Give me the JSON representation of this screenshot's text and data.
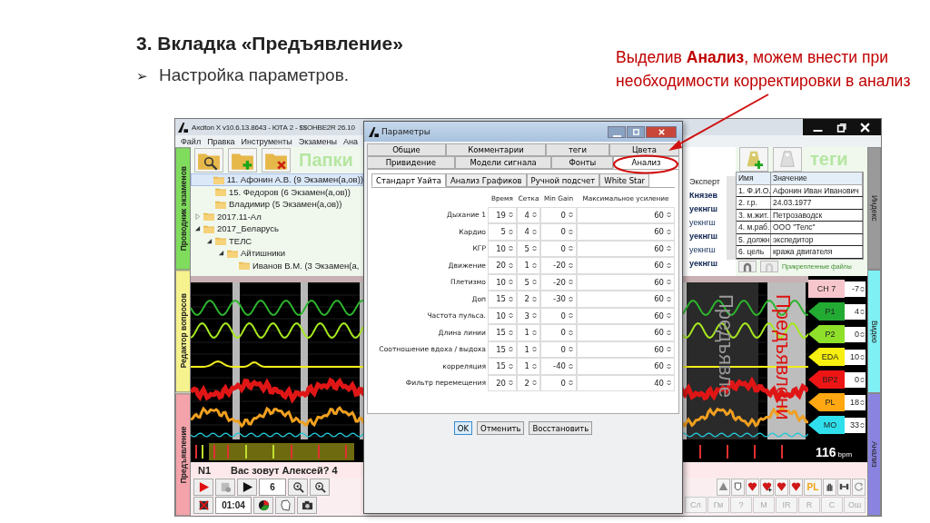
{
  "slide": {
    "title": "3. Вкладка «Предъявление»",
    "bullet": "➢",
    "subtitle": "Настройка параметров.",
    "note": "Выделив **Анализ**,  можем внести при необходимости корректировки в анализ"
  },
  "app": {
    "title": "Axciton X v10.6.13.8643 - ЮТА 2 - $$OHBE2R 26.10",
    "menu": [
      "Файл",
      "Правка",
      "Инструменты",
      "Экзамены",
      "Ана"
    ],
    "left_tabs": [
      {
        "label": "Проводник экзаменов",
        "color": "#7fdc5c"
      },
      {
        "label": "Редактор вопросов",
        "color": "#f6f28e"
      },
      {
        "label": "Предъявление",
        "color": "#f4a3ab"
      }
    ],
    "right_tabs": [
      {
        "label": "Индекс",
        "color": "#9a9a9a"
      },
      {
        "label": "Видео",
        "color": "#7ff0f4"
      },
      {
        "label": "Анализ",
        "color": "#8a84e0"
      }
    ],
    "folders_label": "Папки",
    "tree": [
      {
        "children": [
          {
            "label": "11. Афонин А.В. (9 Экзамен(а,ов))",
            "selected": true
          },
          {
            "label": "15. Федоров (6 Экзамен(а,ов))",
            "selected": false
          },
          {
            "label": "Владимир (5 Экзамен(а,ов))",
            "selected": false
          }
        ]
      },
      {
        "label": "2017.11-Ал",
        "selected": false,
        "expanded": false
      },
      {
        "label": "2017_Беларусь",
        "selected": false,
        "expanded": true,
        "children": [
          {
            "label": "ТЕЛС",
            "selected": false,
            "expanded": true,
            "children": [
              {
                "label": "Айтишники",
                "selected": false,
                "expanded": true,
                "children": [
                  {
                    "label": "Иванов В.М. (3 Экзамен(а,",
                    "selected": false
                  }
                ]
              }
            ]
          }
        ]
      }
    ],
    "experts": {
      "header": "Эксперт",
      "items": [
        {
          "name": "Князев",
          "bold": true
        },
        {
          "name": "уекнгш",
          "bold": true
        },
        {
          "name": "уекнгш",
          "bold": false
        },
        {
          "name": "уекнгш",
          "bold": true
        },
        {
          "name": "уекнгш",
          "bold": false
        },
        {
          "name": "уекнгш",
          "bold": true
        }
      ]
    },
    "tags": {
      "title": "теги",
      "columns": [
        "Имя",
        "Значение"
      ],
      "rows": [
        [
          "1. Ф.И.О.",
          "Афонин Иван Иванович"
        ],
        [
          "2. г.р.",
          "24.03.1977"
        ],
        [
          "3. м.жит.",
          "Петрозаводск"
        ],
        [
          "4. м.раб.",
          "ООО \"Телс\""
        ],
        [
          "5. должн.",
          "экспедитор"
        ],
        [
          "6. цель",
          "кража двигателя"
        ]
      ],
      "files_label": "Прикрепленные файлы"
    },
    "overlay_labels": [
      {
        "text": "Предъявле",
        "color": "#9a9a9a"
      },
      {
        "text": "Предъявлени",
        "color": "#dd1111"
      }
    ],
    "channels": [
      {
        "name": "CH 7",
        "value": "-7",
        "kind": "tab",
        "color": "#f7c6cc"
      },
      {
        "name": "P1",
        "value": "4",
        "kind": "arrow",
        "color": "#22aa33"
      },
      {
        "name": "P2",
        "value": "0",
        "kind": "arrow",
        "color": "#8ee02a"
      },
      {
        "name": "EDA",
        "value": "10",
        "kind": "arrow",
        "color": "#f7ef10"
      },
      {
        "name": "BP2",
        "value": "0",
        "kind": "arrow",
        "color": "#ee1515"
      },
      {
        "name": "PL",
        "value": "18",
        "kind": "arrow",
        "color": "#ffa812"
      },
      {
        "name": "MO",
        "value": "33",
        "kind": "arrow",
        "color": "#2fe0ec"
      }
    ],
    "bpm": "116",
    "bpm_unit": "bpm",
    "question_number": "N1",
    "question": "Вас зовут Алексей? 4",
    "zoom_value": "6",
    "timer": "01:04",
    "pl_label": "PL",
    "letter_buttons": [
      "Сл",
      "Гм",
      "?",
      "M",
      "IR",
      "R",
      "C",
      "Ош"
    ]
  },
  "dialog": {
    "title": "Параметры",
    "tab_rows": [
      [
        {
          "label": "Общие",
          "selected": false
        },
        {
          "label": "Комментарии",
          "selected": false
        },
        {
          "label": "теги",
          "selected": false
        },
        {
          "label": "Цвета",
          "selected": false
        }
      ],
      [
        {
          "label": "Привидение",
          "selected": false
        },
        {
          "label": "Модели сигнала",
          "selected": false
        },
        {
          "label": "Фонты",
          "selected": false
        },
        {
          "label": "Анализ",
          "selected": true
        }
      ]
    ],
    "subtabs": [
      {
        "label": "Стандарт Уайта",
        "selected": true
      },
      {
        "label": "Анализ Графиков",
        "selected": false
      },
      {
        "label": "Ручной подсчет",
        "selected": false
      },
      {
        "label": "White Star",
        "selected": false
      }
    ],
    "columns": [
      "Время",
      "Сетка",
      "Min Gain",
      "Максимальное усиление"
    ],
    "rows": [
      {
        "label": "Дыхание 1",
        "values": [
          "19",
          "4",
          "0",
          "60"
        ]
      },
      {
        "label": "Кардио",
        "values": [
          "5",
          "4",
          "0",
          "60"
        ]
      },
      {
        "label": "КГР",
        "values": [
          "10",
          "5",
          "0",
          "60"
        ]
      },
      {
        "label": "Движение",
        "values": [
          "20",
          "1",
          "-20",
          "60"
        ]
      },
      {
        "label": "Плетизмо",
        "values": [
          "10",
          "5",
          "-20",
          "60"
        ]
      },
      {
        "label": "Доп",
        "values": [
          "15",
          "2",
          "-30",
          "60"
        ]
      },
      {
        "label": "Частота пульса.",
        "values": [
          "10",
          "3",
          "0",
          "60"
        ]
      },
      {
        "label": "Длина линии",
        "values": [
          "15",
          "1",
          "0",
          "60"
        ]
      },
      {
        "label": "Соотношение вдоха / выдоха",
        "values": [
          "15",
          "1",
          "0",
          "60"
        ]
      },
      {
        "label": "корреляция",
        "values": [
          "15",
          "1",
          "-40",
          "60"
        ]
      },
      {
        "label": "Фильтр перемещения",
        "values": [
          "20",
          "2",
          "0",
          "40"
        ]
      }
    ],
    "buttons": [
      "OK",
      "Отменить",
      "Восстановить"
    ]
  }
}
